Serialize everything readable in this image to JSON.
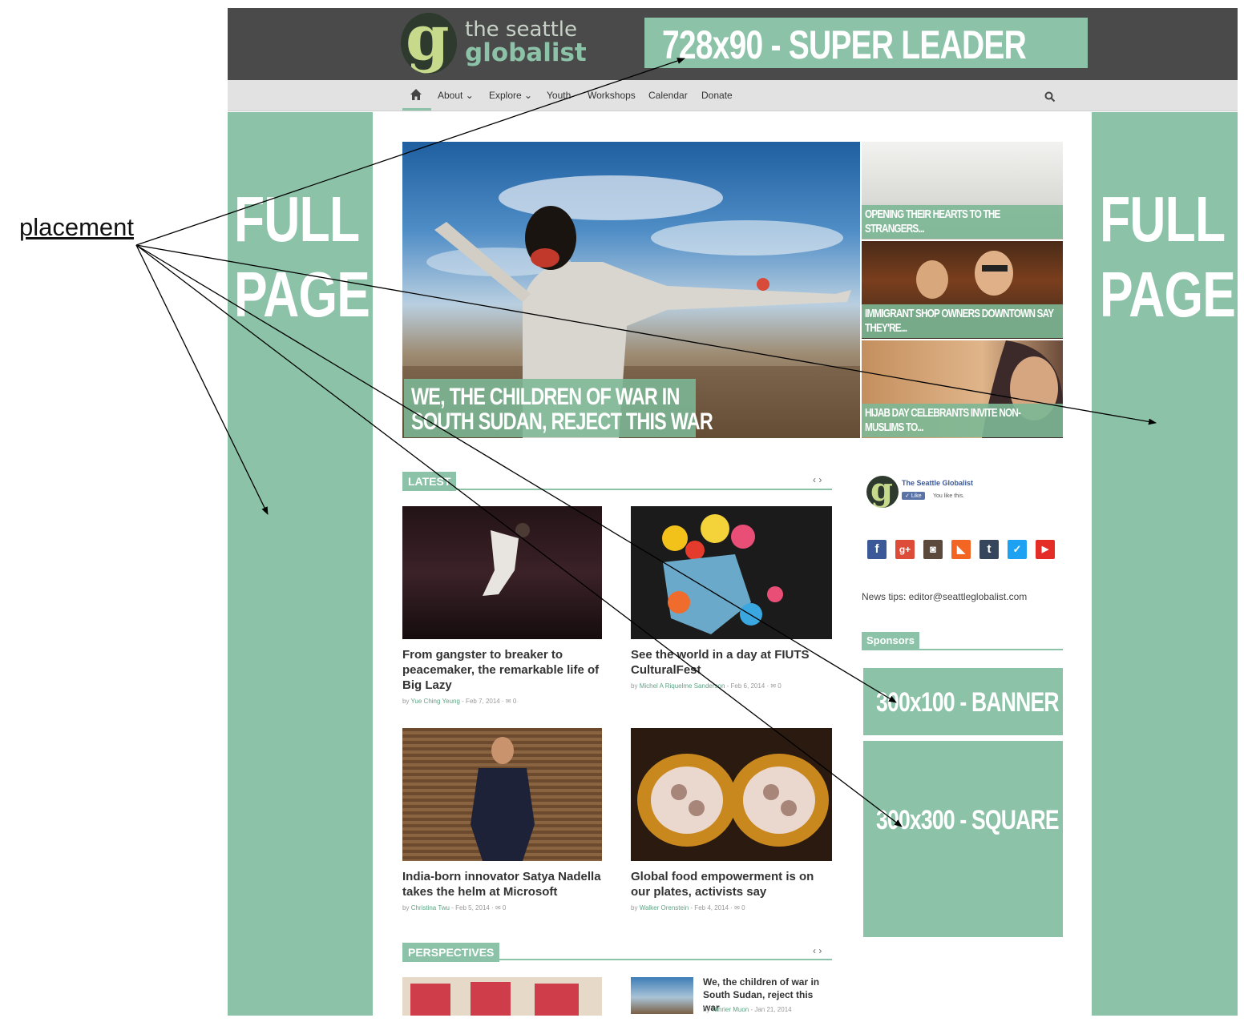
{
  "logo": {
    "mark": "g",
    "line1": "the seattle",
    "line2": "globalist"
  },
  "ads": {
    "super_leader": "728x90 - SUPER LEADER",
    "full_page_left": [
      "FULL",
      "PAGE"
    ],
    "full_page_right": [
      "FULL",
      "PAGE"
    ],
    "banner": "300x100 - BANNER",
    "square": "300x300 - SQUARE"
  },
  "nav": {
    "items": [
      "About ⌄",
      "Explore ⌄",
      "Youth",
      "Workshops",
      "Calendar",
      "Donate"
    ]
  },
  "hero": {
    "main_caption": [
      "WE, THE CHILDREN OF WAR IN",
      "SOUTH SUDAN, REJECT THIS WAR"
    ],
    "side": [
      {
        "caption": [
          "OPENING THEIR HEARTS TO THE",
          "STRANGERS..."
        ]
      },
      {
        "caption": [
          "IMMIGRANT SHOP OWNERS DOWNTOWN SAY",
          "THEY'RE..."
        ]
      },
      {
        "caption": [
          "HIJAB DAY CELEBRANTS INVITE NON-",
          "MUSLIMS TO..."
        ]
      }
    ]
  },
  "latest": {
    "label": "LATEST",
    "arrows": "‹ ›",
    "posts": [
      {
        "title": "From gangster to breaker to peacemaker, the remarkable life of Big Lazy",
        "by": "by",
        "author": "Yue Ching Yeung",
        "date": "- Feb 7, 2014",
        "comments": "0"
      },
      {
        "title": "See the world in a day at FIUTS CulturalFest",
        "by": "by",
        "author": "Michel A Riquelme Sanderson",
        "date": "- Feb 6, 2014",
        "comments": "0"
      },
      {
        "title": "India-born innovator Satya Nadella takes the helm at Microsoft",
        "by": "by",
        "author": "Christina Twu",
        "date": "- Feb 5, 2014",
        "comments": "0"
      },
      {
        "title": "Global food empowerment is on our plates, activists say",
        "by": "by",
        "author": "Walker Orenstein",
        "date": "- Feb 4, 2014",
        "comments": "0"
      }
    ]
  },
  "perspectives": {
    "label": "PERSPECTIVES",
    "arrows": "‹ ›",
    "side_post": {
      "title": "We, the children of war in South Sudan, reject this war",
      "by": "by",
      "author": "Tahrier Muon",
      "date": "- Jan 21, 2014"
    }
  },
  "sidebar": {
    "fb_name": "The Seattle Globalist",
    "fb_like": "Like",
    "fb_you": "You like this.",
    "news_tips": "News tips: editor@seattleglobalist.com",
    "sponsors_label": "Sponsors"
  },
  "social": [
    {
      "name": "facebook-icon",
      "glyph": "f",
      "color": "#3b5998"
    },
    {
      "name": "google-plus-icon",
      "glyph": "g+",
      "color": "#dd4b39"
    },
    {
      "name": "instagram-icon",
      "glyph": "◙",
      "color": "#5b4a3c"
    },
    {
      "name": "rss-icon",
      "glyph": "◣",
      "color": "#f26522"
    },
    {
      "name": "tumblr-icon",
      "glyph": "t",
      "color": "#35465c"
    },
    {
      "name": "twitter-icon",
      "glyph": "✓",
      "color": "#1da1f2"
    },
    {
      "name": "youtube-icon",
      "glyph": "▶",
      "color": "#e52d27"
    }
  ],
  "annotation": {
    "label": "placement"
  },
  "colors": {
    "accent": "#8cc3a8",
    "header": "#4a4a4a",
    "nav": "#e2e2e2"
  }
}
